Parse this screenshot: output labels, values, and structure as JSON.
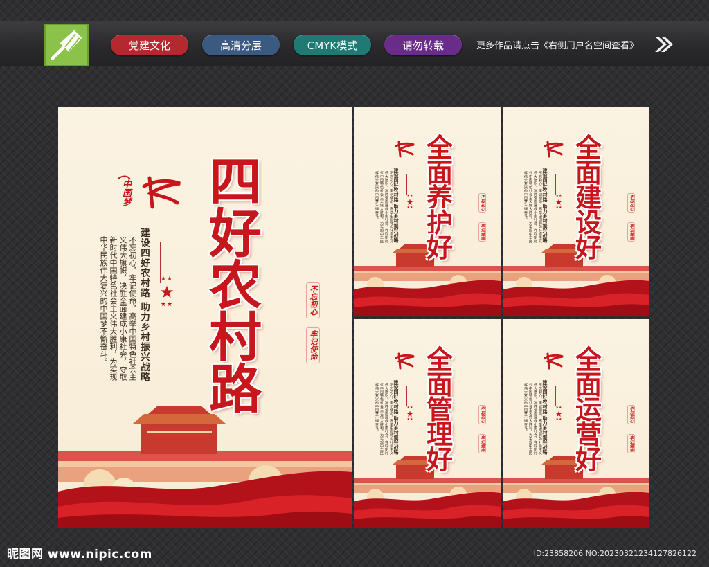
{
  "header": {
    "badges": [
      {
        "label": "党建文化",
        "color": "#b5282f"
      },
      {
        "label": "高清分层",
        "color": "#3b5a82"
      },
      {
        "label": "CMYK模式",
        "color": "#1f7a74"
      },
      {
        "label": "请勿转载",
        "color": "#6a2c8a"
      }
    ],
    "more_link": "更多作品请点击《右侧用户名空间查看》"
  },
  "posters": {
    "main": {
      "title": [
        "四",
        "好",
        "农",
        "村",
        "路"
      ],
      "slogan": "建设四好农村路 助力乡村振兴战略",
      "body": "不忘初心，牢记使命，高举中国特色社会主义伟大旗帜，决胜全面建成小康社会，夺取新时代中国特色社会主义伟大胜利，为实现中华民族伟大复兴的中国梦不懈奋斗。",
      "seal_a": "不忘初心",
      "seal_b": "牢记使命",
      "mark": "中国梦"
    },
    "small": [
      {
        "title": [
          "全",
          "面",
          "养",
          "护",
          "好"
        ]
      },
      {
        "title": [
          "全",
          "面",
          "建",
          "设",
          "好"
        ]
      },
      {
        "title": [
          "全",
          "面",
          "管",
          "理",
          "好"
        ]
      },
      {
        "title": [
          "全",
          "面",
          "运",
          "营",
          "好"
        ]
      }
    ]
  },
  "footer": {
    "site": "昵图网 www.nipic.com",
    "id_line": "ID:23858206 NO:20230321234127826122"
  },
  "colors": {
    "accent_red": "#c8161d",
    "paper": "#fbf3e2",
    "logo_green": "#8bc34a"
  }
}
